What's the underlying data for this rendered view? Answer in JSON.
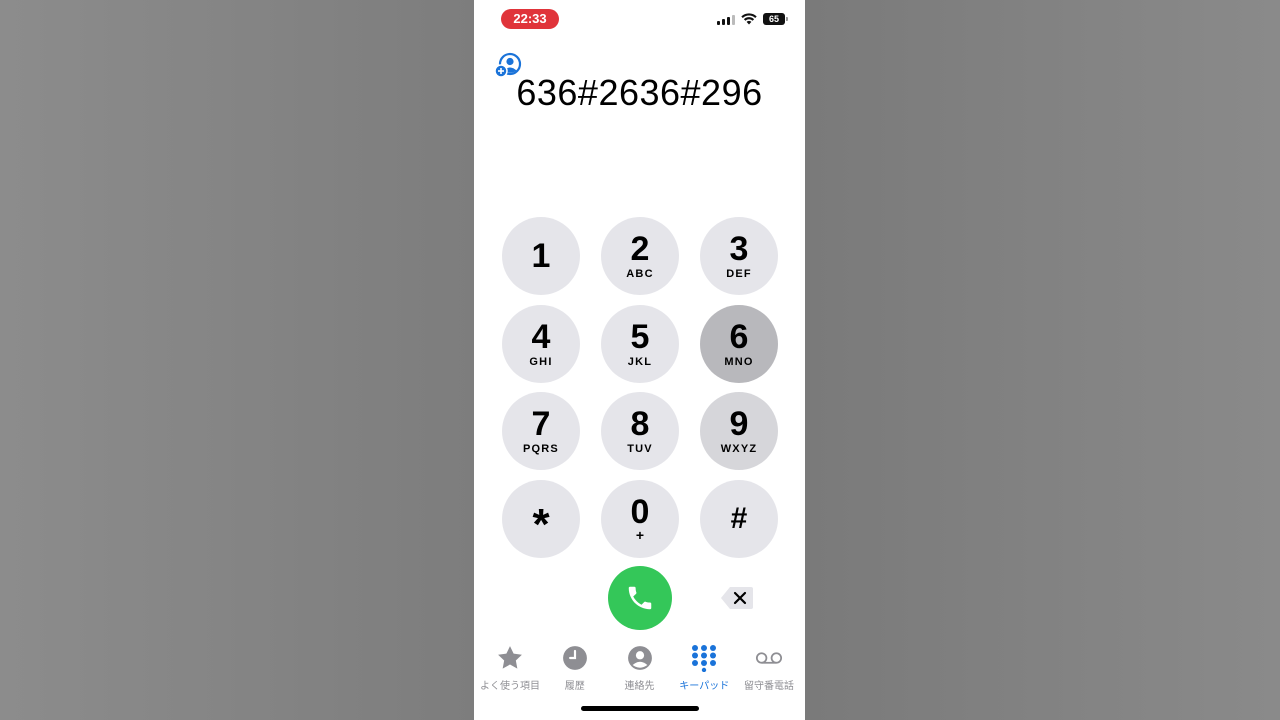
{
  "status_bar": {
    "time": "22:33",
    "battery": "65",
    "icons": [
      "cellular-signal-icon",
      "wifi-icon",
      "battery-icon"
    ],
    "time_pill_color": "#e0343a"
  },
  "display": {
    "number": "636#2636#296",
    "add_contact_icon": "add-contact-icon"
  },
  "keypad": {
    "keys": [
      {
        "digit": "1",
        "letters": ""
      },
      {
        "digit": "2",
        "letters": "ABC"
      },
      {
        "digit": "3",
        "letters": "DEF"
      },
      {
        "digit": "4",
        "letters": "GHI"
      },
      {
        "digit": "5",
        "letters": "JKL"
      },
      {
        "digit": "6",
        "letters": "MNO"
      },
      {
        "digit": "7",
        "letters": "PQRS"
      },
      {
        "digit": "8",
        "letters": "TUV"
      },
      {
        "digit": "9",
        "letters": "WXYZ"
      },
      {
        "digit": "*",
        "letters": ""
      },
      {
        "digit": "0",
        "letters": "+"
      },
      {
        "digit": "#",
        "letters": ""
      }
    ],
    "pressed_key": "6"
  },
  "actions": {
    "call_icon": "phone-icon",
    "delete_icon": "backspace-icon",
    "call_color": "#34c759"
  },
  "tabbar": {
    "tabs": [
      {
        "label": "よく使う項目",
        "icon": "star-icon",
        "active": false
      },
      {
        "label": "履歴",
        "icon": "clock-icon",
        "active": false
      },
      {
        "label": "連絡先",
        "icon": "person-icon",
        "active": false
      },
      {
        "label": "キーパッド",
        "icon": "keypad-icon",
        "active": true
      },
      {
        "label": "留守番電話",
        "icon": "voicemail-icon",
        "active": false
      }
    ],
    "active_color": "#1a73d9",
    "inactive_color": "#8e8e93"
  }
}
